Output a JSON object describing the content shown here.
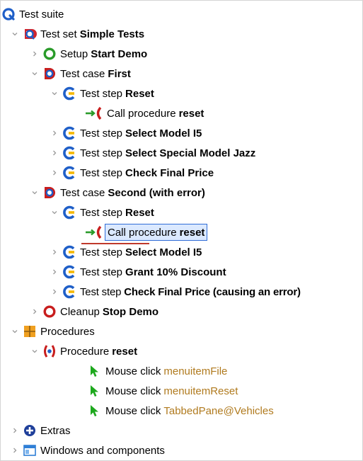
{
  "tree": {
    "root": {
      "prefix": "Test suite"
    },
    "testset": {
      "prefix": "Test set",
      "name": "Simple Tests"
    },
    "setup": {
      "prefix": "Setup",
      "name": "Start Demo"
    },
    "case1": {
      "prefix": "Test case",
      "name": "First"
    },
    "c1_step_reset": {
      "prefix": "Test step",
      "name": "Reset"
    },
    "c1_call": {
      "prefix": "Call procedure",
      "name": "reset"
    },
    "c1_step_i5": {
      "prefix": "Test step",
      "name": "Select Model I5"
    },
    "c1_step_jazz": {
      "prefix": "Test step",
      "name": "Select Special Model Jazz"
    },
    "c1_step_price": {
      "prefix": "Test step",
      "name": "Check Final Price"
    },
    "case2": {
      "prefix": "Test case",
      "name": "Second (with error)"
    },
    "c2_step_reset": {
      "prefix": "Test step",
      "name": "Reset"
    },
    "c2_call": {
      "prefix": "Call procedure",
      "name": "reset"
    },
    "c2_step_i5": {
      "prefix": "Test step",
      "name": "Select Model I5"
    },
    "c2_step_discount": {
      "prefix": "Test step",
      "name": "Grant 10% Discount"
    },
    "c2_step_price": {
      "prefix": "Test step",
      "name": "Check Final Price (causing an error)"
    },
    "cleanup": {
      "prefix": "Cleanup",
      "name": "Stop Demo"
    },
    "procedures": {
      "prefix": "Procedures"
    },
    "proc_reset": {
      "prefix": "Procedure",
      "name": "reset"
    },
    "click1": {
      "prefix": "Mouse click",
      "target": "menuitemFile"
    },
    "click2": {
      "prefix": "Mouse click",
      "target": "menuitemReset"
    },
    "click3": {
      "prefix": "Mouse click",
      "target": "TabbedPane@Vehicles"
    },
    "extras": {
      "prefix": "Extras"
    },
    "windows": {
      "prefix": "Windows and components"
    }
  },
  "selected_node": "c2_call",
  "colors": {
    "suite": "#1f5fc8",
    "testset_red": "#d0262e",
    "testset_blue": "#1f5fc8",
    "setup": "#2a9b2a",
    "cleanup": "#c81e1e",
    "step_blue": "#1f5fc8",
    "step_yellow": "#f5b800",
    "call_green": "#2a9b2a",
    "call_red": "#c81e1e",
    "procedures_orange": "#f0a020",
    "click_green": "#1ea81e",
    "argument": "#b07a1e",
    "selection_bg": "#dbe9ff",
    "selection_border": "#2f6cd6"
  },
  "icons": {
    "suite": "suite-q-icon",
    "testset": "testset-icon",
    "setup": "setup-ring-icon",
    "testcase": "testcase-icon",
    "teststep": "teststep-icon",
    "call": "call-procedure-icon",
    "cleanup": "cleanup-ring-icon",
    "procedures": "procedures-icon",
    "procedure": "procedure-icon",
    "mouseclick": "mouse-click-icon",
    "extras": "extras-icon",
    "windows": "windows-components-icon"
  }
}
